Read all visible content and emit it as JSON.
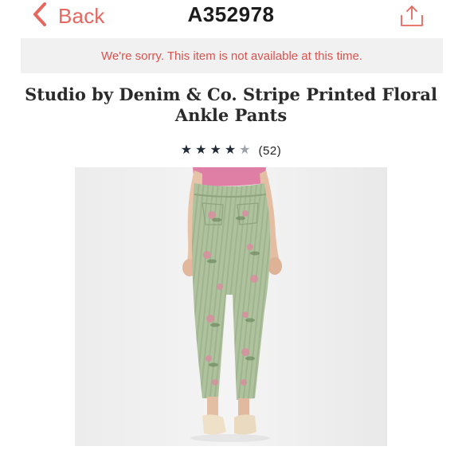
{
  "nav": {
    "back_label": "Back",
    "back_icon": "chevron-left-icon",
    "item_number": "A352978",
    "share_icon": "share-icon"
  },
  "alert": {
    "message": "We're sorry. This item is not available at this time."
  },
  "product": {
    "title": "Studio by Denim & Co. Stripe Printed Floral Ankle Pants",
    "rating": {
      "value": 4,
      "max": 5,
      "count_label": "(52)"
    },
    "image_alt": "Model wearing green floral stripe printed ankle pants, back view"
  },
  "colors": {
    "accent": "#e5675f",
    "alert_text": "#d9534f",
    "alert_bg": "#f1f1f1",
    "star_filled": "#222a36",
    "star_empty": "#9ea3ab",
    "pants_green": "#a9bf9a",
    "top_pink": "#e07fa6"
  }
}
